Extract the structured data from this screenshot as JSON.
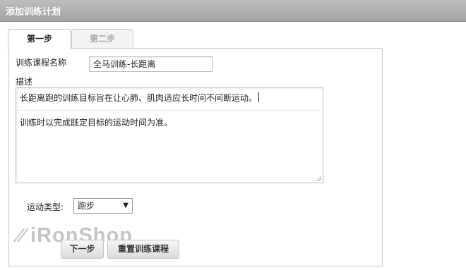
{
  "header": {
    "title": "添加训练计划"
  },
  "tabs": [
    {
      "label": "第一步",
      "active": true
    },
    {
      "label": "第二步",
      "active": false
    }
  ],
  "form": {
    "course_name_label": "训练课程名称",
    "course_name_value": "全马训练-长距离",
    "description_label": "描述",
    "description_line1": "长距离跑的训练目标旨在让心肺、肌肉适应长时间不间断运动。",
    "description_line2": "训练时以完成既定目标的运动时间为准。",
    "sport_type_label": "运动类型:",
    "sport_type_value": "跑步"
  },
  "buttons": {
    "next_label": "下一步",
    "reset_label": "重置训练课程"
  },
  "watermark": {
    "mark": "⁄⁄",
    "text": "iRonShop"
  },
  "colors": {
    "header_bg": "#b0b0b0",
    "border": "#c8c8c8"
  }
}
